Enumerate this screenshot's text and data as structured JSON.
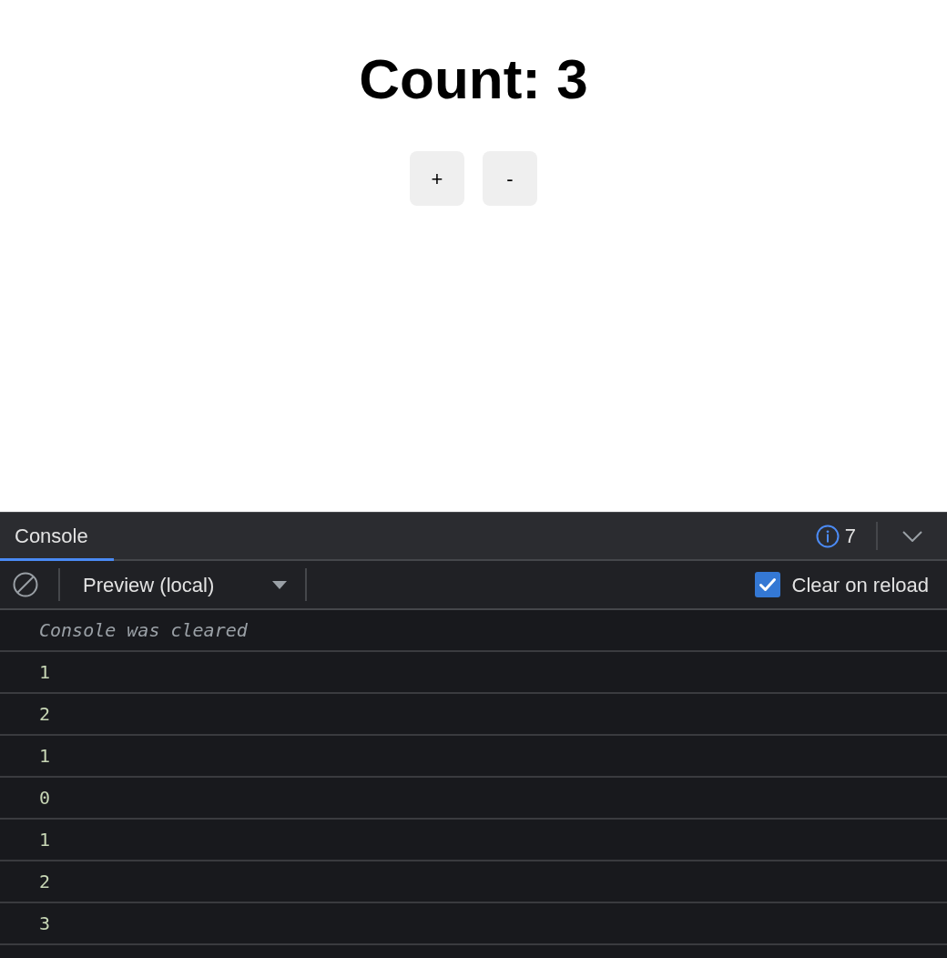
{
  "page": {
    "heading": "Count: 3",
    "buttons": [
      {
        "label": "+"
      },
      {
        "label": "-"
      }
    ]
  },
  "devtools": {
    "tabs": [
      {
        "label": "Console",
        "selected": true
      }
    ],
    "message_count": "7"
  },
  "toolbar": {
    "context": "Preview (local)",
    "clear_on_reload": {
      "label": "Clear on reload",
      "checked": true
    }
  },
  "console": {
    "messages": [
      {
        "kind": "info",
        "text": "Console was cleared"
      },
      {
        "kind": "log",
        "text": "1"
      },
      {
        "kind": "log",
        "text": "2"
      },
      {
        "kind": "log",
        "text": "1"
      },
      {
        "kind": "log",
        "text": "0"
      },
      {
        "kind": "log",
        "text": "1"
      },
      {
        "kind": "log",
        "text": "2"
      },
      {
        "kind": "log",
        "text": "3"
      }
    ]
  }
}
